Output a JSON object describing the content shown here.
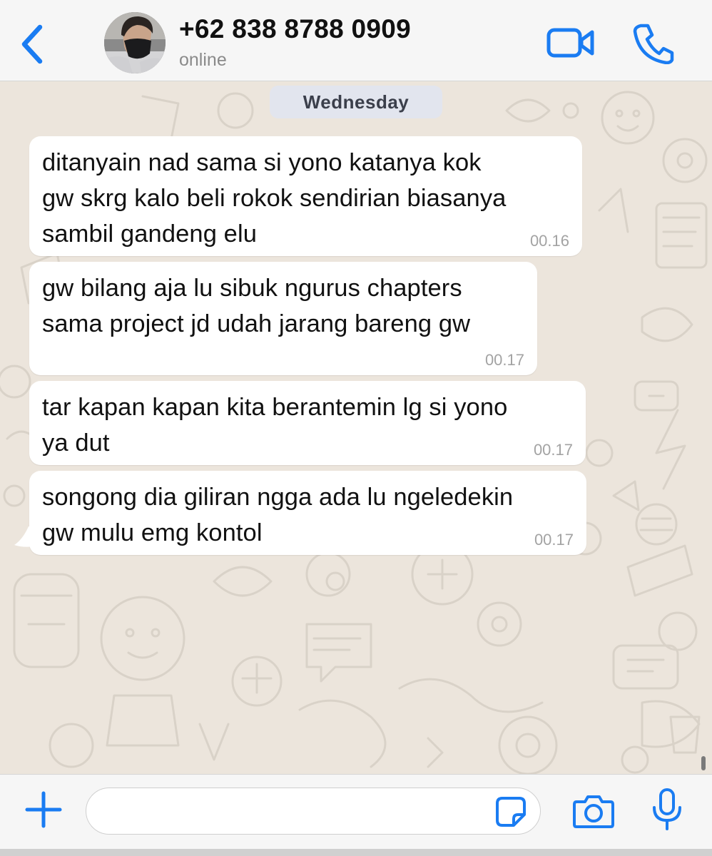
{
  "header": {
    "contact_name": "+62 838 8788 0909",
    "contact_status": "online",
    "icons": {
      "back": "chevron-left-icon",
      "video": "video-camera-icon",
      "call": "phone-icon"
    },
    "accent_color": "#1a7cf2"
  },
  "chat": {
    "date_label": "Wednesday",
    "messages": [
      {
        "text": "ditanyain nad sama si yono katanya kok\ngw skrg kalo beli rokok sendirian biasanya\nsambil gandeng elu",
        "time": "00.16"
      },
      {
        "text": "gw bilang aja lu sibuk ngurus chapters\nsama project jd udah jarang bareng gw",
        "time": "00.17"
      },
      {
        "text": "tar kapan kapan kita berantemin lg si yono\nya dut",
        "time": "00.17"
      },
      {
        "text": "songong dia giliran ngga ada lu ngeledekin\ngw mulu emg kontol",
        "time": "00.17"
      }
    ],
    "background_color": "#ece5dc",
    "bubble_color": "#ffffff"
  },
  "footer": {
    "input_value": "",
    "icons": {
      "plus": "plus-icon",
      "sticker": "sticker-icon",
      "camera": "camera-icon",
      "mic": "microphone-icon"
    }
  }
}
